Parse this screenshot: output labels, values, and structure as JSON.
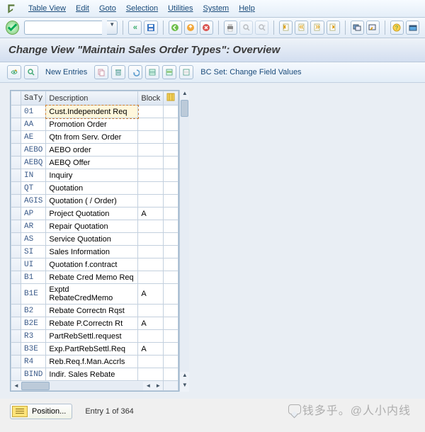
{
  "menu": {
    "items": [
      "Table View",
      "Edit",
      "Goto",
      "Selection",
      "Utilities",
      "System",
      "Help"
    ]
  },
  "cmd": {
    "value": ""
  },
  "title": "Change View \"Maintain Sales Order Types\": Overview",
  "apptool": {
    "new_entries": "New Entries",
    "bcset": "BC Set: Change Field Values"
  },
  "table": {
    "headers": {
      "saty": "SaTy",
      "desc": "Description",
      "block": "Block"
    },
    "rows": [
      {
        "saty": "01",
        "desc": "Cust.Independent Req",
        "block": "",
        "selected": true
      },
      {
        "saty": "AA",
        "desc": "Promotion Order",
        "block": ""
      },
      {
        "saty": "AE",
        "desc": "Qtn from Serv. Order",
        "block": ""
      },
      {
        "saty": "AEBO",
        "desc": "AEBO order",
        "block": ""
      },
      {
        "saty": "AEBQ",
        "desc": "AEBQ Offer",
        "block": ""
      },
      {
        "saty": "IN",
        "desc": "Inquiry",
        "block": ""
      },
      {
        "saty": "QT",
        "desc": "Quotation",
        "block": ""
      },
      {
        "saty": "AGIS",
        "desc": "Quotation ( / Order)",
        "block": ""
      },
      {
        "saty": "AP",
        "desc": "Project Quotation",
        "block": "A"
      },
      {
        "saty": "AR",
        "desc": "Repair Quotation",
        "block": ""
      },
      {
        "saty": "AS",
        "desc": "Service Quotation",
        "block": ""
      },
      {
        "saty": "SI",
        "desc": "Sales Information",
        "block": ""
      },
      {
        "saty": "UI",
        "desc": "Quotation f.contract",
        "block": ""
      },
      {
        "saty": "B1",
        "desc": "Rebate Cred Memo Req",
        "block": ""
      },
      {
        "saty": "B1E",
        "desc": "Exptd RebateCredMemo",
        "block": "A"
      },
      {
        "saty": "B2",
        "desc": "Rebate Correctn Rqst",
        "block": ""
      },
      {
        "saty": "B2E",
        "desc": "Rebate P.Correctn Rt",
        "block": "A"
      },
      {
        "saty": "R3",
        "desc": "PartRebSettl.request",
        "block": ""
      },
      {
        "saty": "B3E",
        "desc": "Exp.PartRebSettl.Req",
        "block": "A"
      },
      {
        "saty": "R4",
        "desc": "Reb.Req.f.Man.Accrls",
        "block": ""
      },
      {
        "saty": "BIND",
        "desc": "Indir. Sales Rebate",
        "block": ""
      }
    ]
  },
  "footer": {
    "position": "Position...",
    "entry": "Entry 1 of 364"
  },
  "watermark": "钱多乎。@人小内线"
}
